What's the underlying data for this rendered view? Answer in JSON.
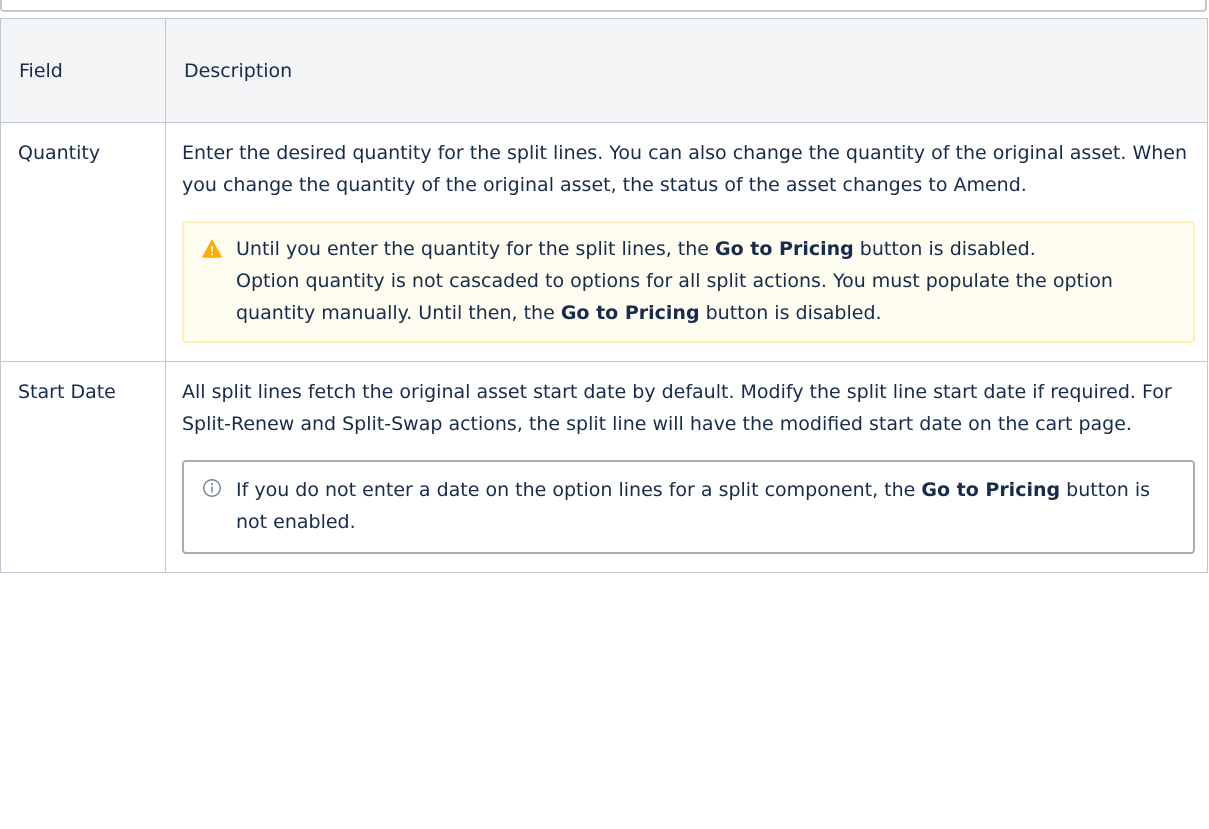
{
  "table": {
    "header": {
      "field": "Field",
      "description": "Description"
    },
    "rows": [
      {
        "field": "Quantity",
        "description": "Enter the desired quantity for the split lines. You can also change the quantity of the original asset. When you change the quantity of the original asset, the status of the asset changes to Amend.",
        "note": {
          "type": "warning",
          "icon": "warning-icon",
          "line1_a": "Until you enter the quantity for the split lines, the ",
          "line1_bold": "Go to Pricing",
          "line1_b": " button is disabled.",
          "line2_a": "Option quantity is not cascaded to options for all split actions. You must populate the option quantity manually. Until then, the ",
          "line2_bold": "Go to Pricing",
          "line2_b": " button is disabled."
        }
      },
      {
        "field": "Start Date",
        "description": "All split lines fetch the original asset start date by default. Modify the split line start date if required. For Split-Renew and Split-Swap actions, the split line will have the modified start date on the cart page.",
        "note": {
          "type": "info",
          "icon": "info-icon",
          "line1_a": "If you do not enter a date on the option lines for a split component, the ",
          "line1_bold": "Go to Pricing",
          "line1_b": " button is not enabled."
        }
      }
    ]
  },
  "colors": {
    "warning_bg": "#fffcf0",
    "warning_border": "#fff0b3",
    "warning_icon": "#ffab00",
    "info_border": "#a5adba",
    "header_bg": "#f4f5f7"
  }
}
